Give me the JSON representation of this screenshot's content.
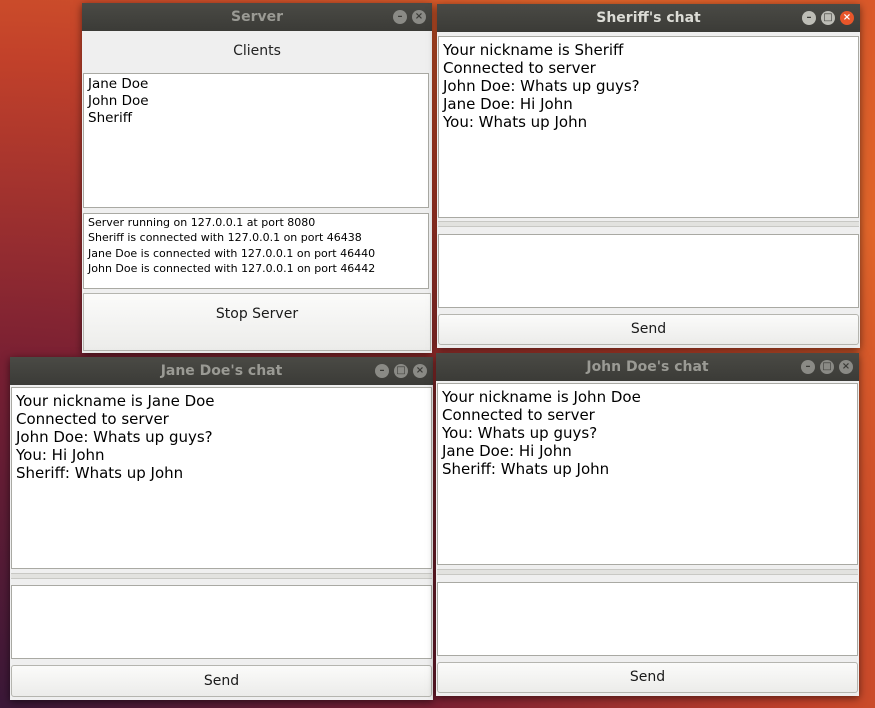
{
  "server": {
    "title": "Server",
    "clients_label": "Clients",
    "clients": [
      "Jane Doe",
      "John Doe",
      "Sheriff"
    ],
    "log": [
      "Server running on 127.0.0.1 at port 8080",
      "Sheriff is connected with 127.0.0.1 on port 46438",
      "Jane Doe is connected with 127.0.0.1 on port 46440",
      "John Doe is connected with 127.0.0.1 on port 46442"
    ],
    "stop_label": "Stop Server"
  },
  "sheriff": {
    "title": "Sheriff's chat",
    "messages": [
      "Your nickname is Sheriff",
      "Connected to server",
      "John Doe: Whats up guys?",
      "Jane Doe: Hi John",
      "You: Whats up John"
    ],
    "input": "",
    "send_label": "Send"
  },
  "jane": {
    "title": "Jane Doe's chat",
    "messages": [
      "Your nickname is Jane Doe",
      "Connected to server",
      "John Doe: Whats up guys?",
      "You: Hi John",
      "Sheriff: Whats up John"
    ],
    "input": "",
    "send_label": "Send"
  },
  "john": {
    "title": "John Doe's chat",
    "messages": [
      "Your nickname is John Doe",
      "Connected to server",
      "You: Whats up guys?",
      "Jane Doe: Hi John",
      "Sheriff: Whats up John"
    ],
    "input": "",
    "send_label": "Send"
  },
  "controls": {
    "minimize_glyph": "–",
    "maximize_glyph": "□",
    "close_glyph": "×"
  },
  "colors": {
    "titlebar": "#3b3b37",
    "close_active": "#e8562a",
    "desktop": "#c2412a"
  }
}
